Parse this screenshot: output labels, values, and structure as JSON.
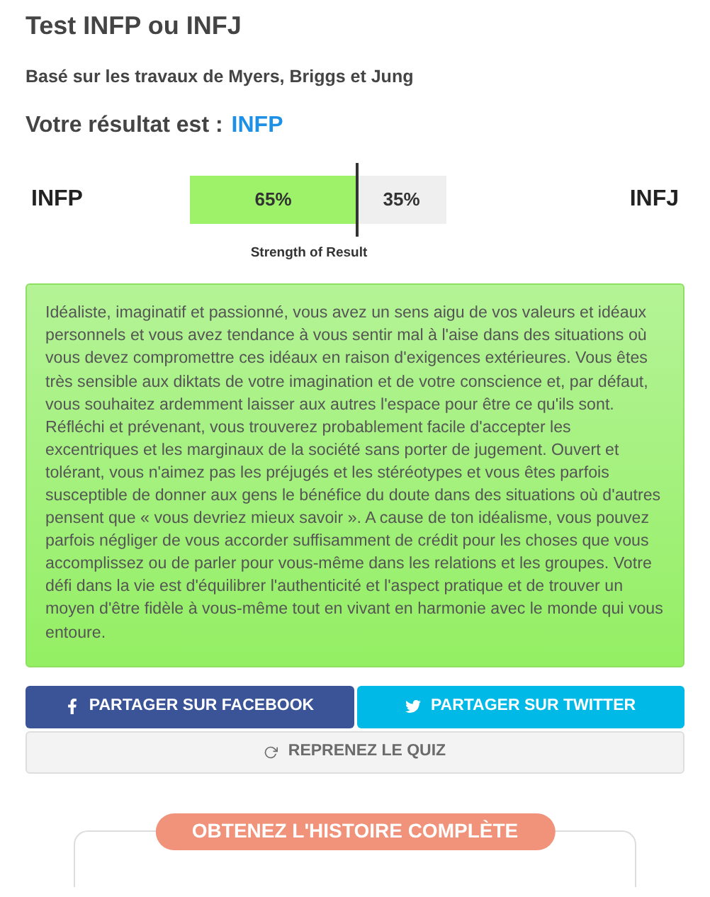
{
  "title": "Test INFP ou INFJ",
  "subtitle": "Basé sur les travaux de Myers, Briggs et Jung",
  "result": {
    "label": "Votre résultat est :",
    "type": "INFP"
  },
  "meter": {
    "left_label": "INFP",
    "right_label": "INFJ",
    "level": 0.65,
    "left_reading": "65%",
    "right_reading": "35%",
    "caption": "Strength of Result"
  },
  "description": "Idéaliste, imaginatif et passionné, vous avez un sens aigu de vos valeurs et idéaux personnels et vous avez tendance à vous sentir mal à l'aise dans des situations où vous devez compromettre ces idéaux en raison d'exigences extérieures. Vous êtes très sensible aux diktats de votre imagination et de votre conscience et, par défaut, vous souhaitez ardemment laisser aux autres l'espace pour être ce qu'ils sont. Réfléchi et prévenant, vous trouverez probablement facile d'accepter les excentriques et les marginaux de la société sans porter de jugement. Ouvert et tolérant, vous n'aimez pas les préjugés et les stéréotypes et vous êtes parfois susceptible de donner aux gens le bénéfice du doute dans des situations où d'autres pensent que « vous devriez mieux savoir ». A cause de ton idéalisme, vous pouvez parfois négliger de vous accorder suffisamment de crédit pour les choses que vous accomplissez ou de parler pour vous-même dans les relations et les groupes. Votre défi dans la vie est d'équilibrer l'authenticité et l'aspect pratique et de trouver un moyen d'être fidèle à vous-même tout en vivant en harmonie avec le monde qui vous entoure.",
  "buttons": [
    {
      "kind": "facebook",
      "label": "PARTAGER SUR FACEBOOK"
    },
    {
      "kind": "twitter",
      "label": "PARTAGER SUR TWITTER"
    },
    {
      "kind": "retake",
      "label": "REPRENEZ LE QUIZ"
    }
  ],
  "story_badge": "OBTENEZ L'HISTOIRE COMPLÈTE"
}
